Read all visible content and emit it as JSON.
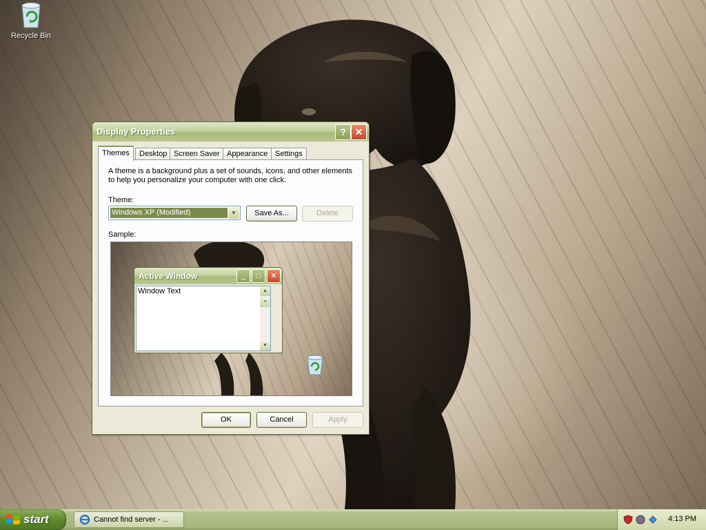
{
  "desktop": {
    "icons": [
      {
        "label": "Recycle Bin",
        "icon": "recycle-bin-icon"
      }
    ]
  },
  "dialog": {
    "title": "Display Properties",
    "title_buttons": [
      "help-icon",
      "close-icon"
    ],
    "tabs": [
      {
        "label": "Themes",
        "active": true
      },
      {
        "label": "Desktop",
        "active": false
      },
      {
        "label": "Screen Saver",
        "active": false
      },
      {
        "label": "Appearance",
        "active": false
      },
      {
        "label": "Settings",
        "active": false
      }
    ],
    "description": "A theme is a background plus a set of sounds, icons, and other elements to help you personalize your computer with one click.",
    "theme_label": "Theme:",
    "theme_value": "Windows XP (Modified)",
    "save_as_label": "Save As...",
    "delete_label": "Delete",
    "sample_label": "Sample:",
    "sample": {
      "window_title": "Active Window",
      "window_text": "Window Text"
    },
    "ok_label": "OK",
    "cancel_label": "Cancel",
    "apply_label": "Apply"
  },
  "taskbar": {
    "start_label": "start",
    "tasks": [
      {
        "label": "Cannot find server - ...",
        "icon": "internet-explorer-icon"
      }
    ],
    "tray_icons": [
      "security-shield-icon",
      "network-icon",
      "update-icon"
    ],
    "clock": "4:13 PM"
  },
  "colors": {
    "title_bar": "#a9ba78",
    "taskbar": "#a8b57c",
    "start_button": "#5f8a2c",
    "selection": "#7d8a4d"
  }
}
